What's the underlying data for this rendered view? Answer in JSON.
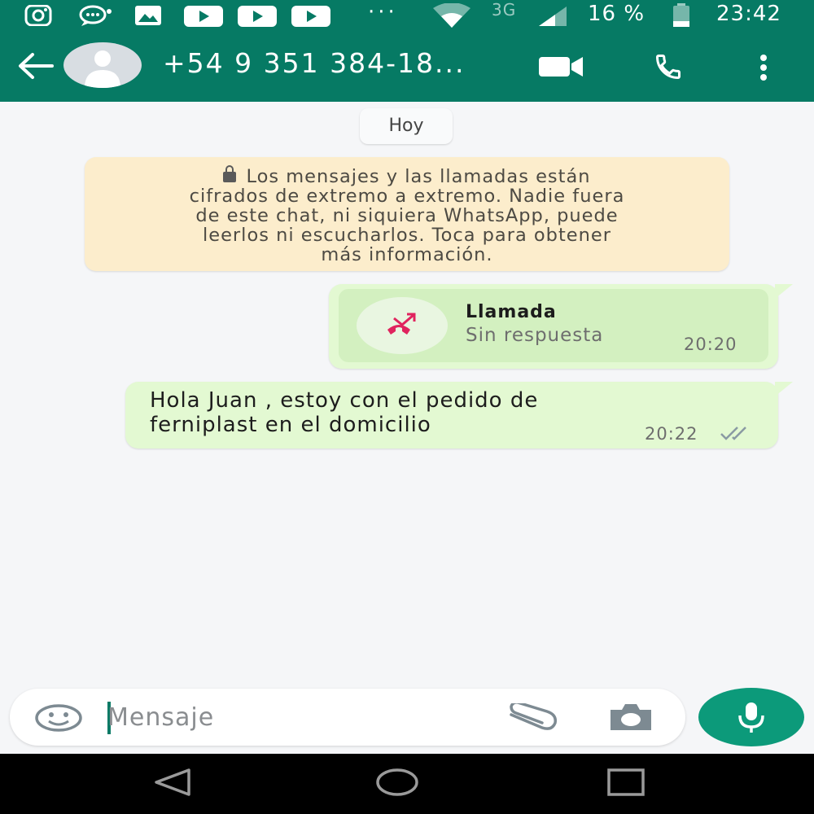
{
  "status_bar": {
    "network": "3G",
    "battery_percent": "16 %",
    "time": "23:42",
    "icons": [
      "instagram-icon",
      "chat-notification-icon",
      "gallery-icon",
      "youtube-icon",
      "youtube-icon",
      "youtube-icon",
      "more-dots-icon",
      "wifi-icon",
      "signal-icon",
      "battery-icon"
    ]
  },
  "header": {
    "contact_name": "+54 9 351 384-18...",
    "icons": [
      "back-arrow-icon",
      "avatar",
      "video-call-icon",
      "phone-icon",
      "more-vert-icon"
    ]
  },
  "chat": {
    "date_label": "Hoy",
    "encryption_notice": [
      "Los mensajes y las llamadas están",
      "cifrados de extremo a extremo. Nadie fuera",
      "de este chat, ni siquiera WhatsApp, puede",
      "leerlos ni escucharlos. Toca para obtener",
      "más información."
    ],
    "call_message": {
      "title": "Llamada",
      "subtitle": "Sin respuesta",
      "time": "20:20"
    },
    "text_message": {
      "lines": [
        "Hola Juan , estoy con el pedido de",
        "ferniplast en el domicilio"
      ],
      "time": "20:22",
      "status": "delivered"
    }
  },
  "composer": {
    "placeholder": "Mensaje",
    "value": ""
  },
  "colors": {
    "header": "#067a64",
    "outgoing_bubble": "#e3f9d2",
    "notice": "#fcedcc",
    "mic_button": "#0c9a7a",
    "missed_call": "#e0245e"
  }
}
